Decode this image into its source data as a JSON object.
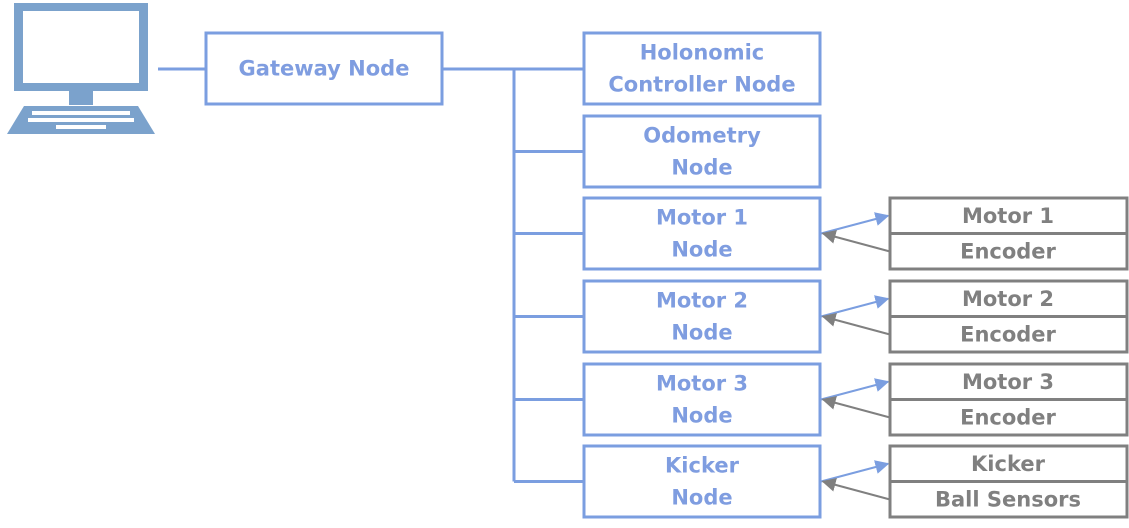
{
  "colors": {
    "node": "#7b9ee0",
    "node_text": "#7f9de0",
    "peripheral": "#808080",
    "computer": "#7ba2cc"
  },
  "computer": {
    "icon": "laptop-computer-icon"
  },
  "gateway": {
    "lines": [
      "Gateway Node"
    ]
  },
  "nodes": [
    {
      "lines": [
        "Holonomic",
        "Controller Node"
      ],
      "peripherals": []
    },
    {
      "lines": [
        "Odometry",
        "Node"
      ],
      "peripherals": []
    },
    {
      "lines": [
        "Motor 1",
        "Node"
      ],
      "peripherals": [
        "Motor 1",
        "Encoder"
      ]
    },
    {
      "lines": [
        "Motor 2",
        "Node"
      ],
      "peripherals": [
        "Motor 2",
        "Encoder"
      ]
    },
    {
      "lines": [
        "Motor 3",
        "Node"
      ],
      "peripherals": [
        "Motor 3",
        "Encoder"
      ]
    },
    {
      "lines": [
        "Kicker",
        "Node"
      ],
      "peripherals": [
        "Kicker",
        "Ball Sensors"
      ]
    }
  ]
}
